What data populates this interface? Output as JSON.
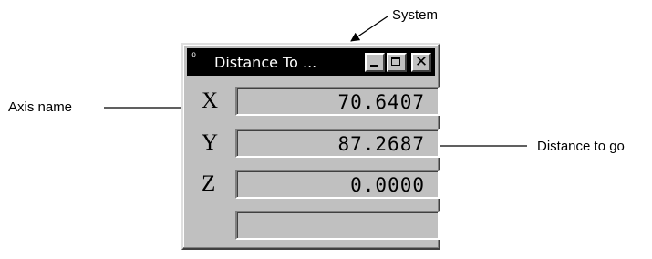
{
  "annotations": {
    "system": "System",
    "axis_name": "Axis name",
    "distance_to_go": "Distance to go"
  },
  "window": {
    "title": "Distance To ...",
    "system_icon_glyph": "ᴼ-",
    "buttons": {
      "minimize": "minimize",
      "maximize": "maximize",
      "close": "✕"
    }
  },
  "axes": [
    {
      "name": "X",
      "value": "70.6407"
    },
    {
      "name": "Y",
      "value": "87.2687"
    },
    {
      "name": "Z",
      "value": "0.0000"
    },
    {
      "name": "",
      "value": ""
    }
  ],
  "colors": {
    "window_face": "#c0c0c0",
    "titlebar": "#000000",
    "title_text": "#ffffff"
  },
  "icons": {
    "system": "system-menu-icon",
    "minimize": "minimize-icon",
    "maximize": "maximize-icon",
    "close": "close-icon"
  }
}
